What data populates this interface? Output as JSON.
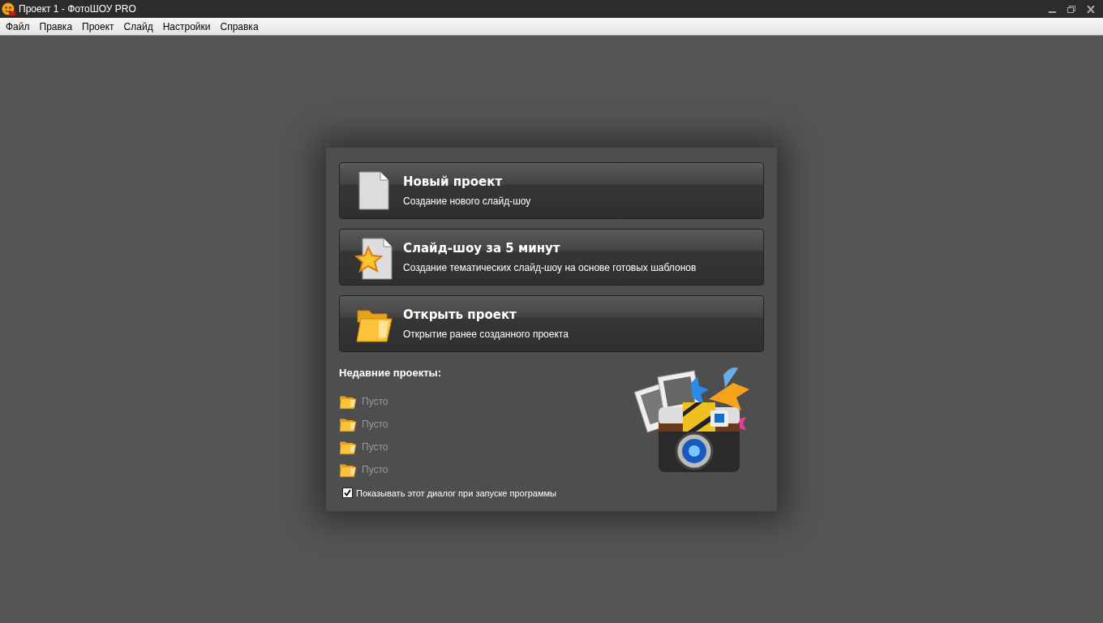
{
  "window": {
    "title": "Проект 1 - ФотоШОУ PRO"
  },
  "menu": [
    "Файл",
    "Правка",
    "Проект",
    "Слайд",
    "Настройки",
    "Справка"
  ],
  "actions": [
    {
      "kind": "blank",
      "title": "Новый проект",
      "subtitle": "Создание нового слайд-шоу"
    },
    {
      "kind": "template",
      "title": "Слайд-шоу за 5 минут",
      "subtitle": "Создание тематических слайд-шоу на основе готовых шаблонов"
    },
    {
      "kind": "folder",
      "title": "Открыть проект",
      "subtitle": "Открытие ранее созданного проекта"
    }
  ],
  "recent": {
    "heading": "Недавние проекты:",
    "items": [
      "Пусто",
      "Пусто",
      "Пусто",
      "Пусто"
    ]
  },
  "startup_checkbox": {
    "label": "Показывать этот диалог при запуске программы",
    "checked": true
  }
}
